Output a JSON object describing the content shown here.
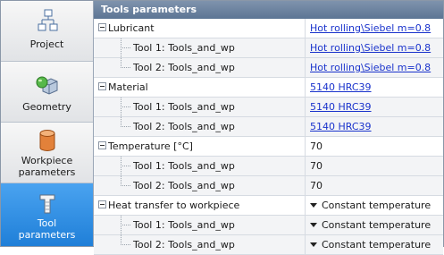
{
  "sidebar": {
    "items": [
      {
        "label": "Project",
        "icon": "project-icon"
      },
      {
        "label": "Geometry",
        "icon": "geometry-icon"
      },
      {
        "label_line1": "Workpiece",
        "label_line2": "parameters",
        "icon": "workpiece-icon"
      },
      {
        "label_line1": "Tool",
        "label_line2": "parameters",
        "icon": "tool-icon",
        "active": true
      }
    ]
  },
  "panel": {
    "title": "Tools parameters",
    "groups": [
      {
        "label": "Lubricant",
        "value": "Hot rolling\\Siebel m=0.8",
        "children": [
          {
            "label": "Tool 1: Tools_and_wp",
            "value": "Hot rolling\\Siebel m=0.8"
          },
          {
            "label": "Tool 2: Tools_and_wp",
            "value": "Hot rolling\\Siebel m=0.8"
          }
        ]
      },
      {
        "label": "Material",
        "value": "5140 HRC39",
        "children": [
          {
            "label": "Tool 1: Tools_and_wp",
            "value": "5140 HRC39"
          },
          {
            "label": "Tool 2: Tools_and_wp",
            "value": "5140 HRC39"
          }
        ]
      },
      {
        "label": "Temperature [°C]",
        "value": "70",
        "children": [
          {
            "label": "Tool 1: Tools_and_wp",
            "value": "70"
          },
          {
            "label": "Tool 2: Tools_and_wp",
            "value": "70"
          }
        ]
      },
      {
        "label": "Heat transfer to workpiece",
        "value": "Constant temperature",
        "children": [
          {
            "label": "Tool 1: Tools_and_wp",
            "value": "Constant temperature"
          },
          {
            "label": "Tool 2: Tools_and_wp",
            "value": "Constant temperature"
          }
        ]
      }
    ]
  },
  "colors": {
    "accent": "#1f7fd8",
    "header": "#6b819f",
    "link": "#1a33cc"
  }
}
